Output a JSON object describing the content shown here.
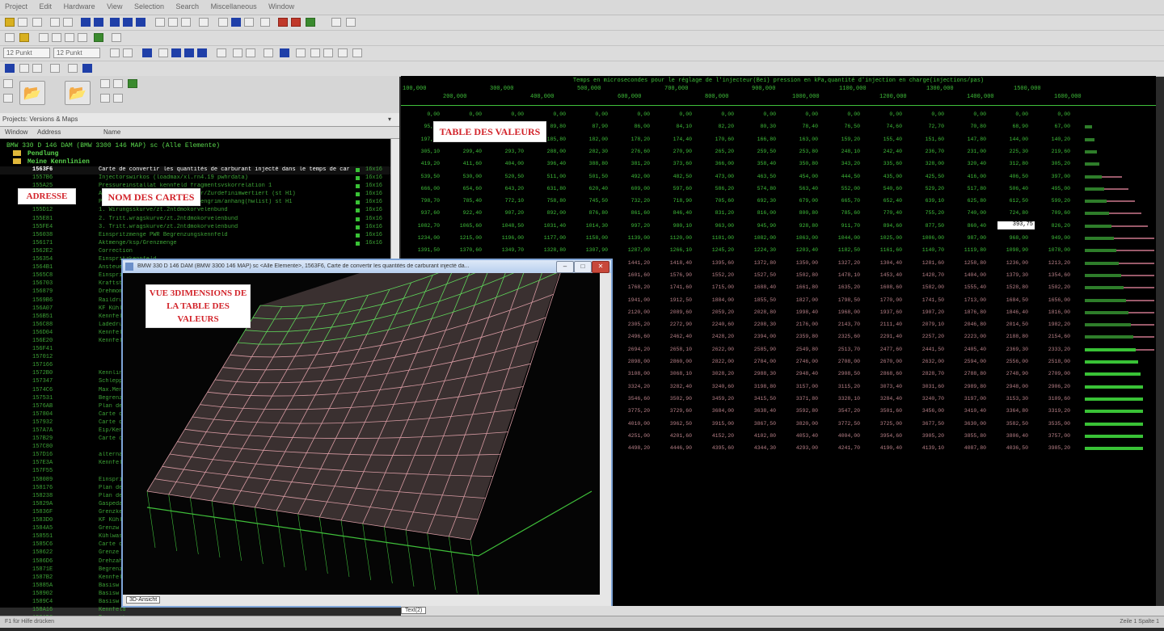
{
  "menu": [
    "Project",
    "Edit",
    "Hardware",
    "View",
    "Selection",
    "Search",
    "Miscellaneous",
    "Window"
  ],
  "font_combo_1": "12 Punkt",
  "font_combo_2": "12 Punkt",
  "projects_label": "Projects: Versions & Maps",
  "columns": {
    "window": "Window",
    "address": "Address",
    "name": "Name"
  },
  "tree": {
    "root": "BMW 330 D 146 DAM (BMW 3300 146 MAP) sc (Alle Elemente)",
    "folder1": "Pendlung",
    "folder2": "Meine Kennlinien"
  },
  "map_rows": [
    {
      "addr": "1563F6",
      "name": "Carte de convertir les quantités de carburant injecté dans le temps de cara",
      "sz": "16x16",
      "sel": true
    },
    {
      "addr": "1557B6",
      "name": "Injectorswirkos (loadmax/xl.rn4.19 pwhrdata)",
      "sz": "16x16"
    },
    {
      "addr": "155A25",
      "name": "Pressureinstallat kennfeld fragmentsvskorrelation 1",
      "sz": "16x16"
    },
    {
      "addr": "155B8C",
      "name": "Ansteuerung/differenzdruck/bgfr/Zurdefinimwertiert (st H1)",
      "sz": "16x16"
    },
    {
      "addr": "155C6B",
      "name": "Pressure/tankfind/mengein/aussengrim/anhang(hwlist) st H1",
      "sz": "16x16"
    },
    {
      "addr": "155D12",
      "name": "1. Wirungsskurve/zt.2ntdmokorvelenbund",
      "sz": "16x16"
    },
    {
      "addr": "155E81",
      "name": "2. Tritt.wragskurve/zt.2ntdmokorvelenbund",
      "sz": "16x16"
    },
    {
      "addr": "155FE4",
      "name": "3. Tritt.wragskurve/zt.2ntdmokorvelenbund",
      "sz": "16x16"
    },
    {
      "addr": "156038",
      "name": "Einspritzmenge PWR Begrenzungskennfeld",
      "sz": "16x16"
    },
    {
      "addr": "156171",
      "name": "Aktmenge/ksp/Grenzmenge",
      "sz": "16x16"
    },
    {
      "addr": "1562E2",
      "name": "Correction"
    },
    {
      "addr": "156354",
      "name": "Einspritzkennfeld"
    },
    {
      "addr": "1564B1",
      "name": "Ansteuerbeginn"
    },
    {
      "addr": "1565C8",
      "name": "Einspritzdauer"
    },
    {
      "addr": "156703",
      "name": "Kraftstoffmenge"
    },
    {
      "addr": "156879",
      "name": "Drehmoment"
    },
    {
      "addr": "1569B6",
      "name": "Raildruck"
    },
    {
      "addr": "156A07",
      "name": "KF Kühlmittel"
    },
    {
      "addr": "156B51",
      "name": "Kennfeld Lader"
    },
    {
      "addr": "156C88",
      "name": "Ladedruck"
    },
    {
      "addr": "156D04",
      "name": "Kennfeld 1"
    },
    {
      "addr": "156E20",
      "name": "Kennfeld 2"
    },
    {
      "addr": "156F41",
      "name": ""
    },
    {
      "addr": "157012",
      "name": ""
    },
    {
      "addr": "157166",
      "name": ""
    },
    {
      "addr": "1572B0",
      "name": "Kennlinie"
    },
    {
      "addr": "157347",
      "name": "Schleppmoment"
    },
    {
      "addr": "1574C6",
      "name": "Max.Menge"
    },
    {
      "addr": "157531",
      "name": "Begrenzung"
    },
    {
      "addr": "1576AB",
      "name": "Plan de"
    },
    {
      "addr": "157804",
      "name": "Carte de"
    },
    {
      "addr": "157932",
      "name": "Carte de"
    },
    {
      "addr": "157A7A",
      "name": "Eip/Kennf"
    },
    {
      "addr": "157B29",
      "name": "Carte de"
    },
    {
      "addr": "157C80",
      "name": ""
    },
    {
      "addr": "157D16",
      "name": "alternativ"
    },
    {
      "addr": "157E3A",
      "name": "Kennfeld"
    },
    {
      "addr": "157F55",
      "name": ""
    },
    {
      "addr": "158089",
      "name": "Einsprit"
    },
    {
      "addr": "158176",
      "name": "Plan de"
    },
    {
      "addr": "158238",
      "name": "Plan de"
    },
    {
      "addr": "15829A",
      "name": "Gaspedal"
    },
    {
      "addr": "15836F",
      "name": "Grenzkennlinie"
    },
    {
      "addr": "1583D0",
      "name": "KF Kühl"
    },
    {
      "addr": "1584A5",
      "name": "Grenzw"
    },
    {
      "addr": "158551",
      "name": "Kühlwasser"
    },
    {
      "addr": "1585C6",
      "name": "Carte de"
    },
    {
      "addr": "158622",
      "name": "Grenze"
    },
    {
      "addr": "1586D6",
      "name": "Drehzahl"
    },
    {
      "addr": "15871E",
      "name": "Begrenz"
    },
    {
      "addr": "1587B2",
      "name": "Kennfeld"
    },
    {
      "addr": "15885A",
      "name": "Basisw"
    },
    {
      "addr": "158902",
      "name": "Basisw"
    },
    {
      "addr": "1589C4",
      "name": "Basisw"
    },
    {
      "addr": "158A16",
      "name": "Kennfeld"
    },
    {
      "addr": "158AD8",
      "name": "Einspritz"
    },
    {
      "addr": "158B92",
      "name": "Kennfeld"
    }
  ],
  "table": {
    "title": "Temps en microsecondes pour le réglage de l'injecteur(Bei) pression en kPa,quantité d'injection en charge(injections/pas)",
    "header_top": [
      "100,000",
      "300,000",
      "500,000",
      "700,000",
      "900,000",
      "1100,000",
      "1300,000",
      "1500,000"
    ],
    "header_bottom": [
      "200,000",
      "400,000",
      "600,000",
      "800,000",
      "1000,000",
      "1200,000",
      "1400,000",
      "1600,000"
    ],
    "selected_value": "393,75"
  },
  "labels": {
    "adresse": "ADRESSE",
    "nom": "NOM DES CARTES",
    "table": "TABLE DES VALEURS",
    "vue3d": "VUE 3DIMENSIONS DE LA TABLE DES VALEURS"
  },
  "win3d": {
    "title": "BMW 330 D 146 DAM (BMW 3300 146 MAP) sc <Alle Elemente>, 1563F6, Carte de convertir les quantités de carburant injecté da...",
    "tab": "3D-Ansicht"
  },
  "right_tab": "Text(2)",
  "status": {
    "left": "F1 für Hilfe drücken",
    "right": "Zeile 1  Spalte 1"
  },
  "colors": {
    "terminal_green": "#3fbf3a",
    "table_pink": "#b88088",
    "label_red": "#d2232a"
  }
}
